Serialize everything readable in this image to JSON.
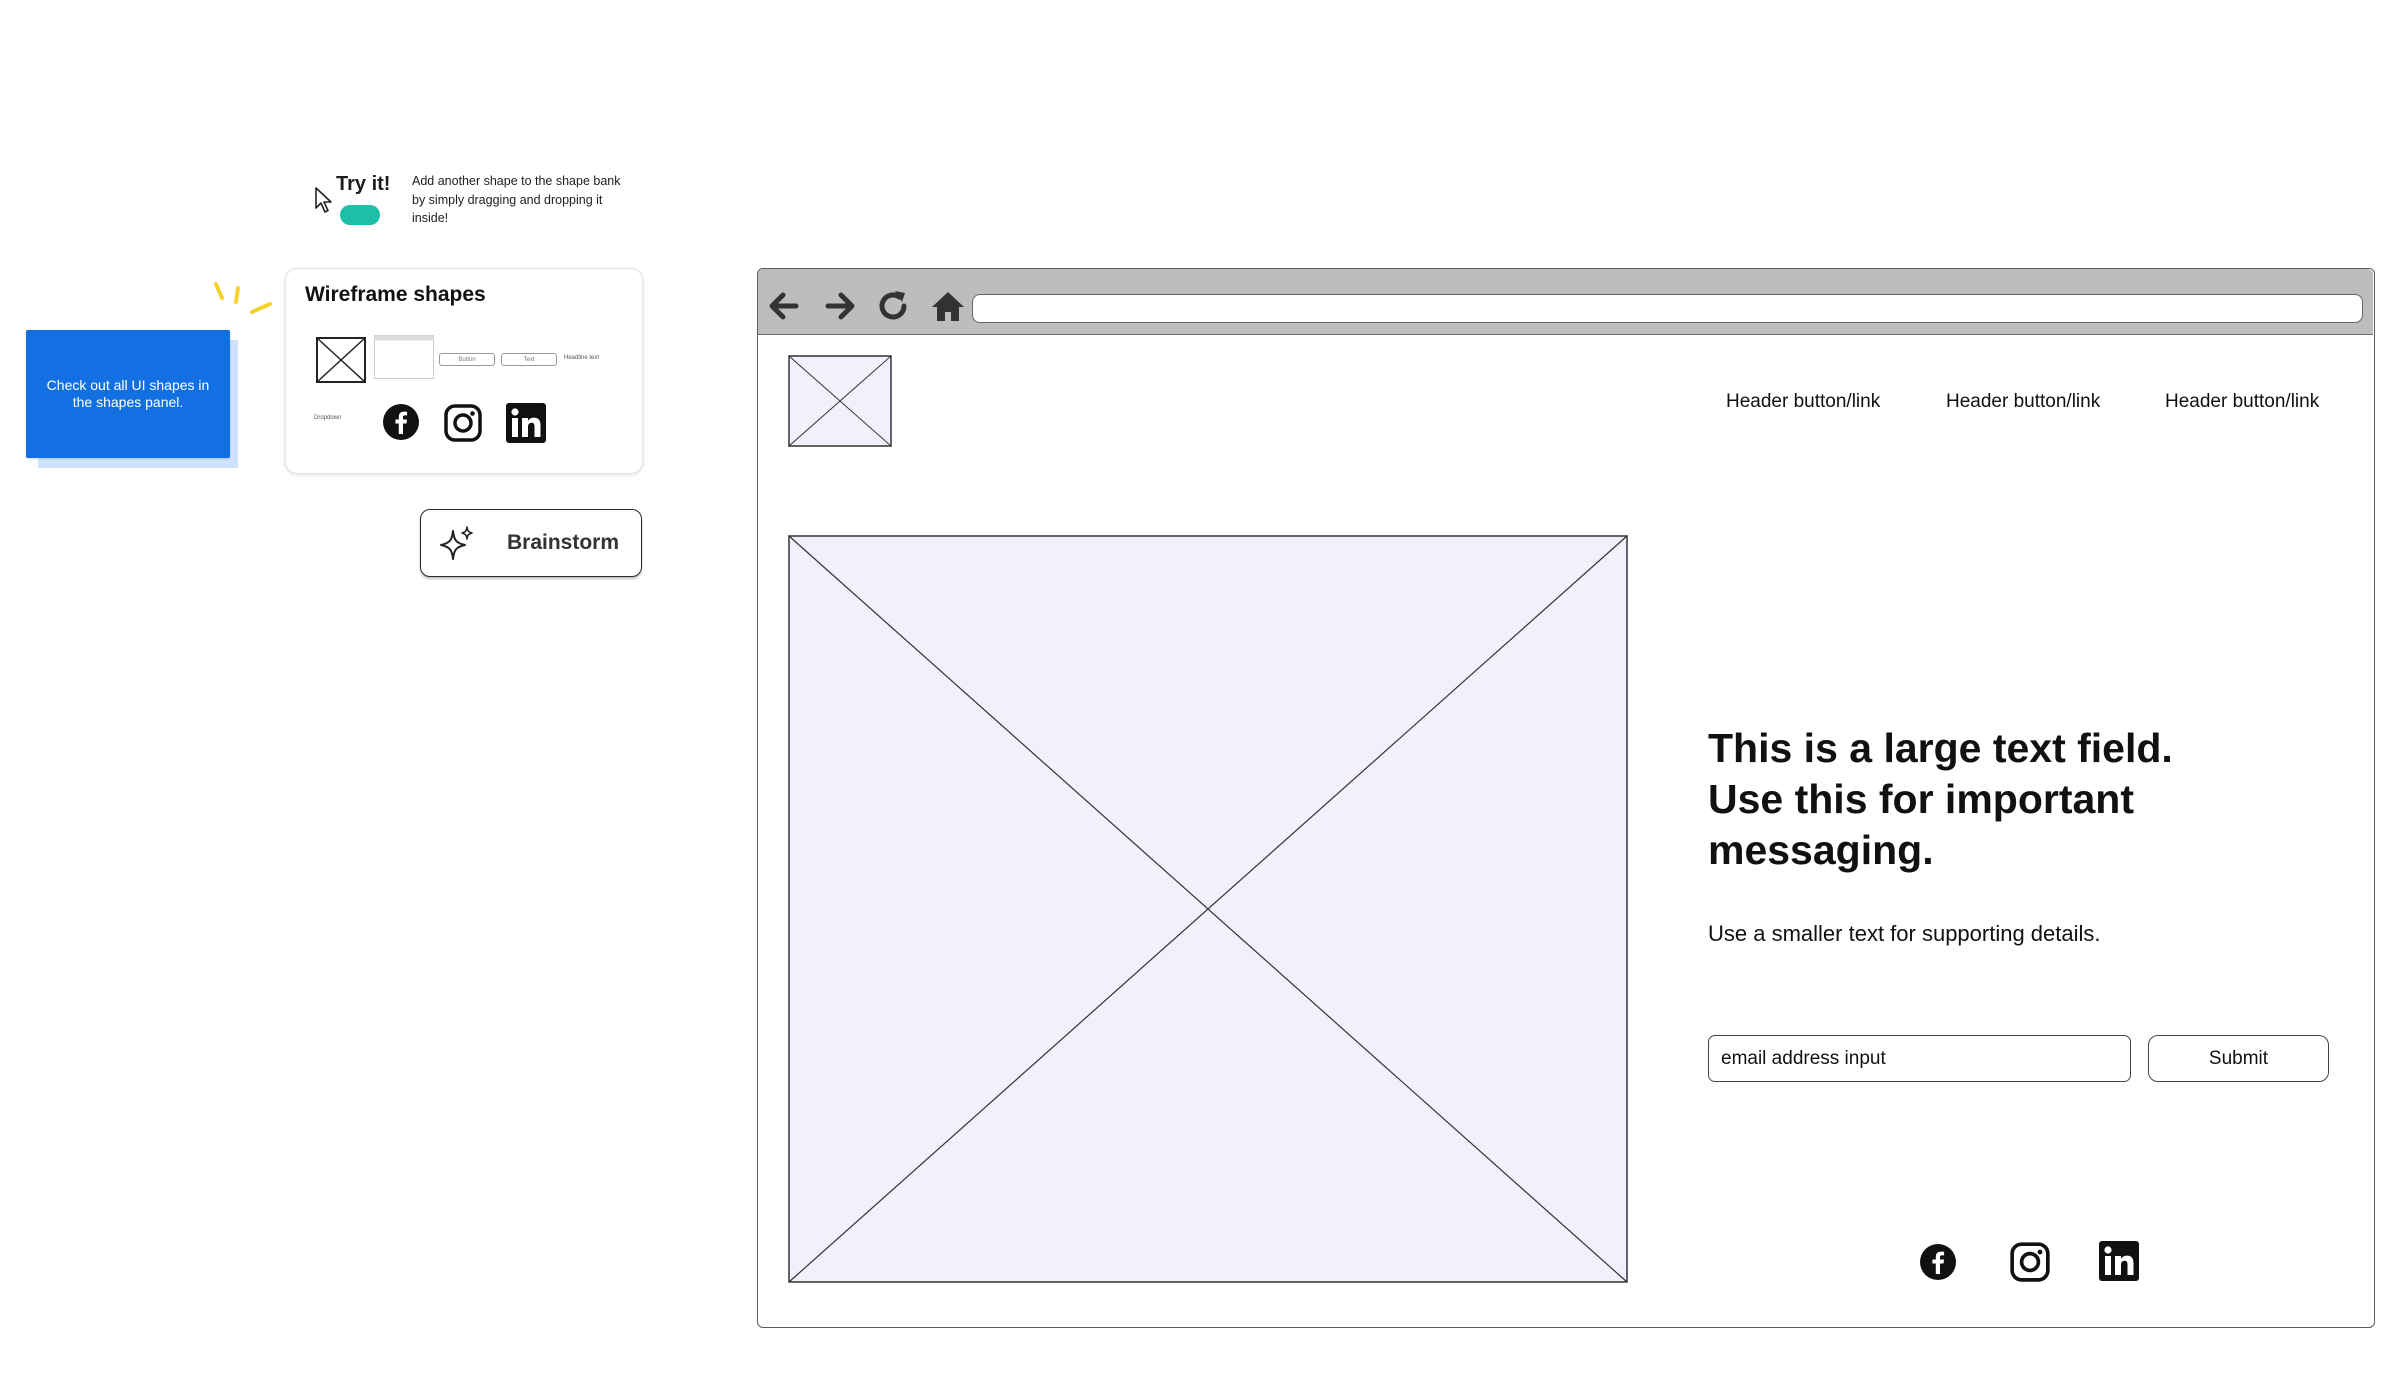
{
  "try_it": {
    "title": "Try it!",
    "description": "Add another shape to the shape bank by simply dragging and dropping it inside!",
    "accent": "#1dbfa6"
  },
  "sticky_note": {
    "text": "Check out all UI shapes in the shapes panel.",
    "color": "#1270e3"
  },
  "shapes_panel": {
    "title": "Wireframe shapes",
    "mini_button_label": "Button",
    "mini_input_label": "Text",
    "mini_headline_label": "Headline text",
    "mini_label": "Dropdown",
    "icons": [
      "facebook-icon",
      "instagram-icon",
      "linkedin-icon"
    ]
  },
  "brainstorm": {
    "label": "Brainstorm",
    "icon": "sparkle-icon"
  },
  "browser": {
    "controls": [
      "back-arrow-icon",
      "forward-arrow-icon",
      "refresh-icon",
      "home-icon"
    ],
    "address_value": "",
    "header_links": [
      "Header button/link",
      "Header button/link",
      "Header button/link"
    ],
    "headline": "This is a large text field. Use this for important messaging.",
    "subtext": "Use a smaller text for supporting details.",
    "email_input_value": "email address input",
    "submit_label": "Submit",
    "social_icons": [
      "facebook-icon",
      "instagram-icon",
      "linkedin-icon"
    ],
    "hero_fill": "#f0f1fc"
  }
}
